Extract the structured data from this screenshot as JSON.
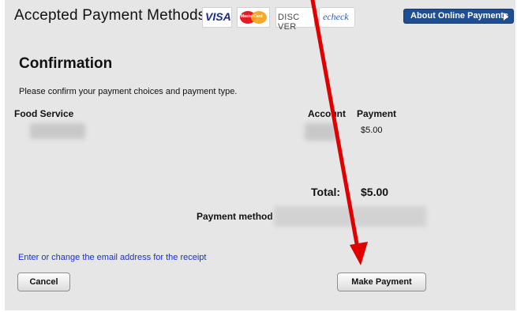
{
  "header": {
    "title": "Accepted Payment Methods",
    "cards": {
      "visa": "VISA",
      "mastercard": "MasterCard",
      "discover": "DISC VER",
      "echeck": "echeck"
    },
    "about_button": "About Online Payments"
  },
  "confirmation": {
    "heading": "Confirmation",
    "instructions": "Please confirm your payment choices and payment type.",
    "columns": {
      "service": "Food Service",
      "account": "Account",
      "payment": "Payment"
    },
    "rows": [
      {
        "payment": "$5.00"
      }
    ],
    "total_label": "Total:",
    "total_value": "$5.00",
    "payment_method_label": "Payment method"
  },
  "email_link": "Enter or change the email address for the receipt",
  "buttons": {
    "cancel": "Cancel",
    "make_payment": "Make Payment"
  },
  "colors": {
    "panel_bg": "#e6e6e6",
    "about_button_bg": "#1f4e92",
    "link": "#1a2ee0",
    "annotation_arrow": "#e00000"
  },
  "icons": {
    "about_button": "triangle-right-icon",
    "annotation": "red-arrow-annotation"
  }
}
